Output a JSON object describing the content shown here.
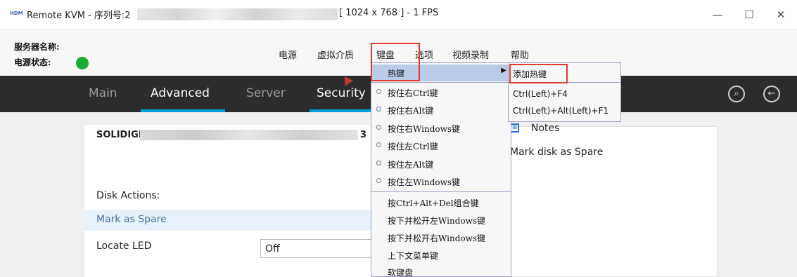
{
  "titlebar": {
    "logo": "HDM",
    "title_prefix": "Remote KVM - 序列号:2",
    "title_suffix": "[ 1024 x 768 ] - 1 FPS",
    "minimize": "—",
    "maximize": "☐",
    "close": "✕"
  },
  "info": {
    "server_name_label": "服务器名称:",
    "power_status_label": "电源状态:",
    "power_color": "#1aac34"
  },
  "menubar": [
    "电源",
    "虚拟介质",
    "键盘",
    "选项",
    "视频录制",
    "帮助"
  ],
  "nav": {
    "items": [
      "Main",
      "Advanced",
      "Server",
      "Security"
    ],
    "active": [
      "Advanced"
    ],
    "accent": "#00a0e0"
  },
  "content": {
    "serial_prefix": "SOLIDIGM",
    "serial_tail": "3",
    "disk_actions": "Disk Actions:",
    "mark_spare": "Mark as Spare",
    "locate_led": "Locate LED",
    "locate_value": "Off",
    "notes_title": "Notes",
    "notes_body": "Mark disk as Spare"
  },
  "keyboard_menu": {
    "hotkey": "热键",
    "radio_items": [
      "按住右Ctrl键",
      "按住右Alt键",
      "按住右Windows键",
      "按住左Ctrl键",
      "按住左Alt键",
      "按住左Windows键"
    ],
    "action_items": [
      "按Ctrl+Alt+Del组合键",
      "按下并松开左Windows键",
      "按下并松开右Windows键",
      "上下文菜单键",
      "软键盘"
    ]
  },
  "hotkey_submenu": {
    "add": "添加热键",
    "items": [
      "Ctrl(Left)+F4",
      "Ctrl(Left)+Alt(Left)+F1"
    ]
  }
}
